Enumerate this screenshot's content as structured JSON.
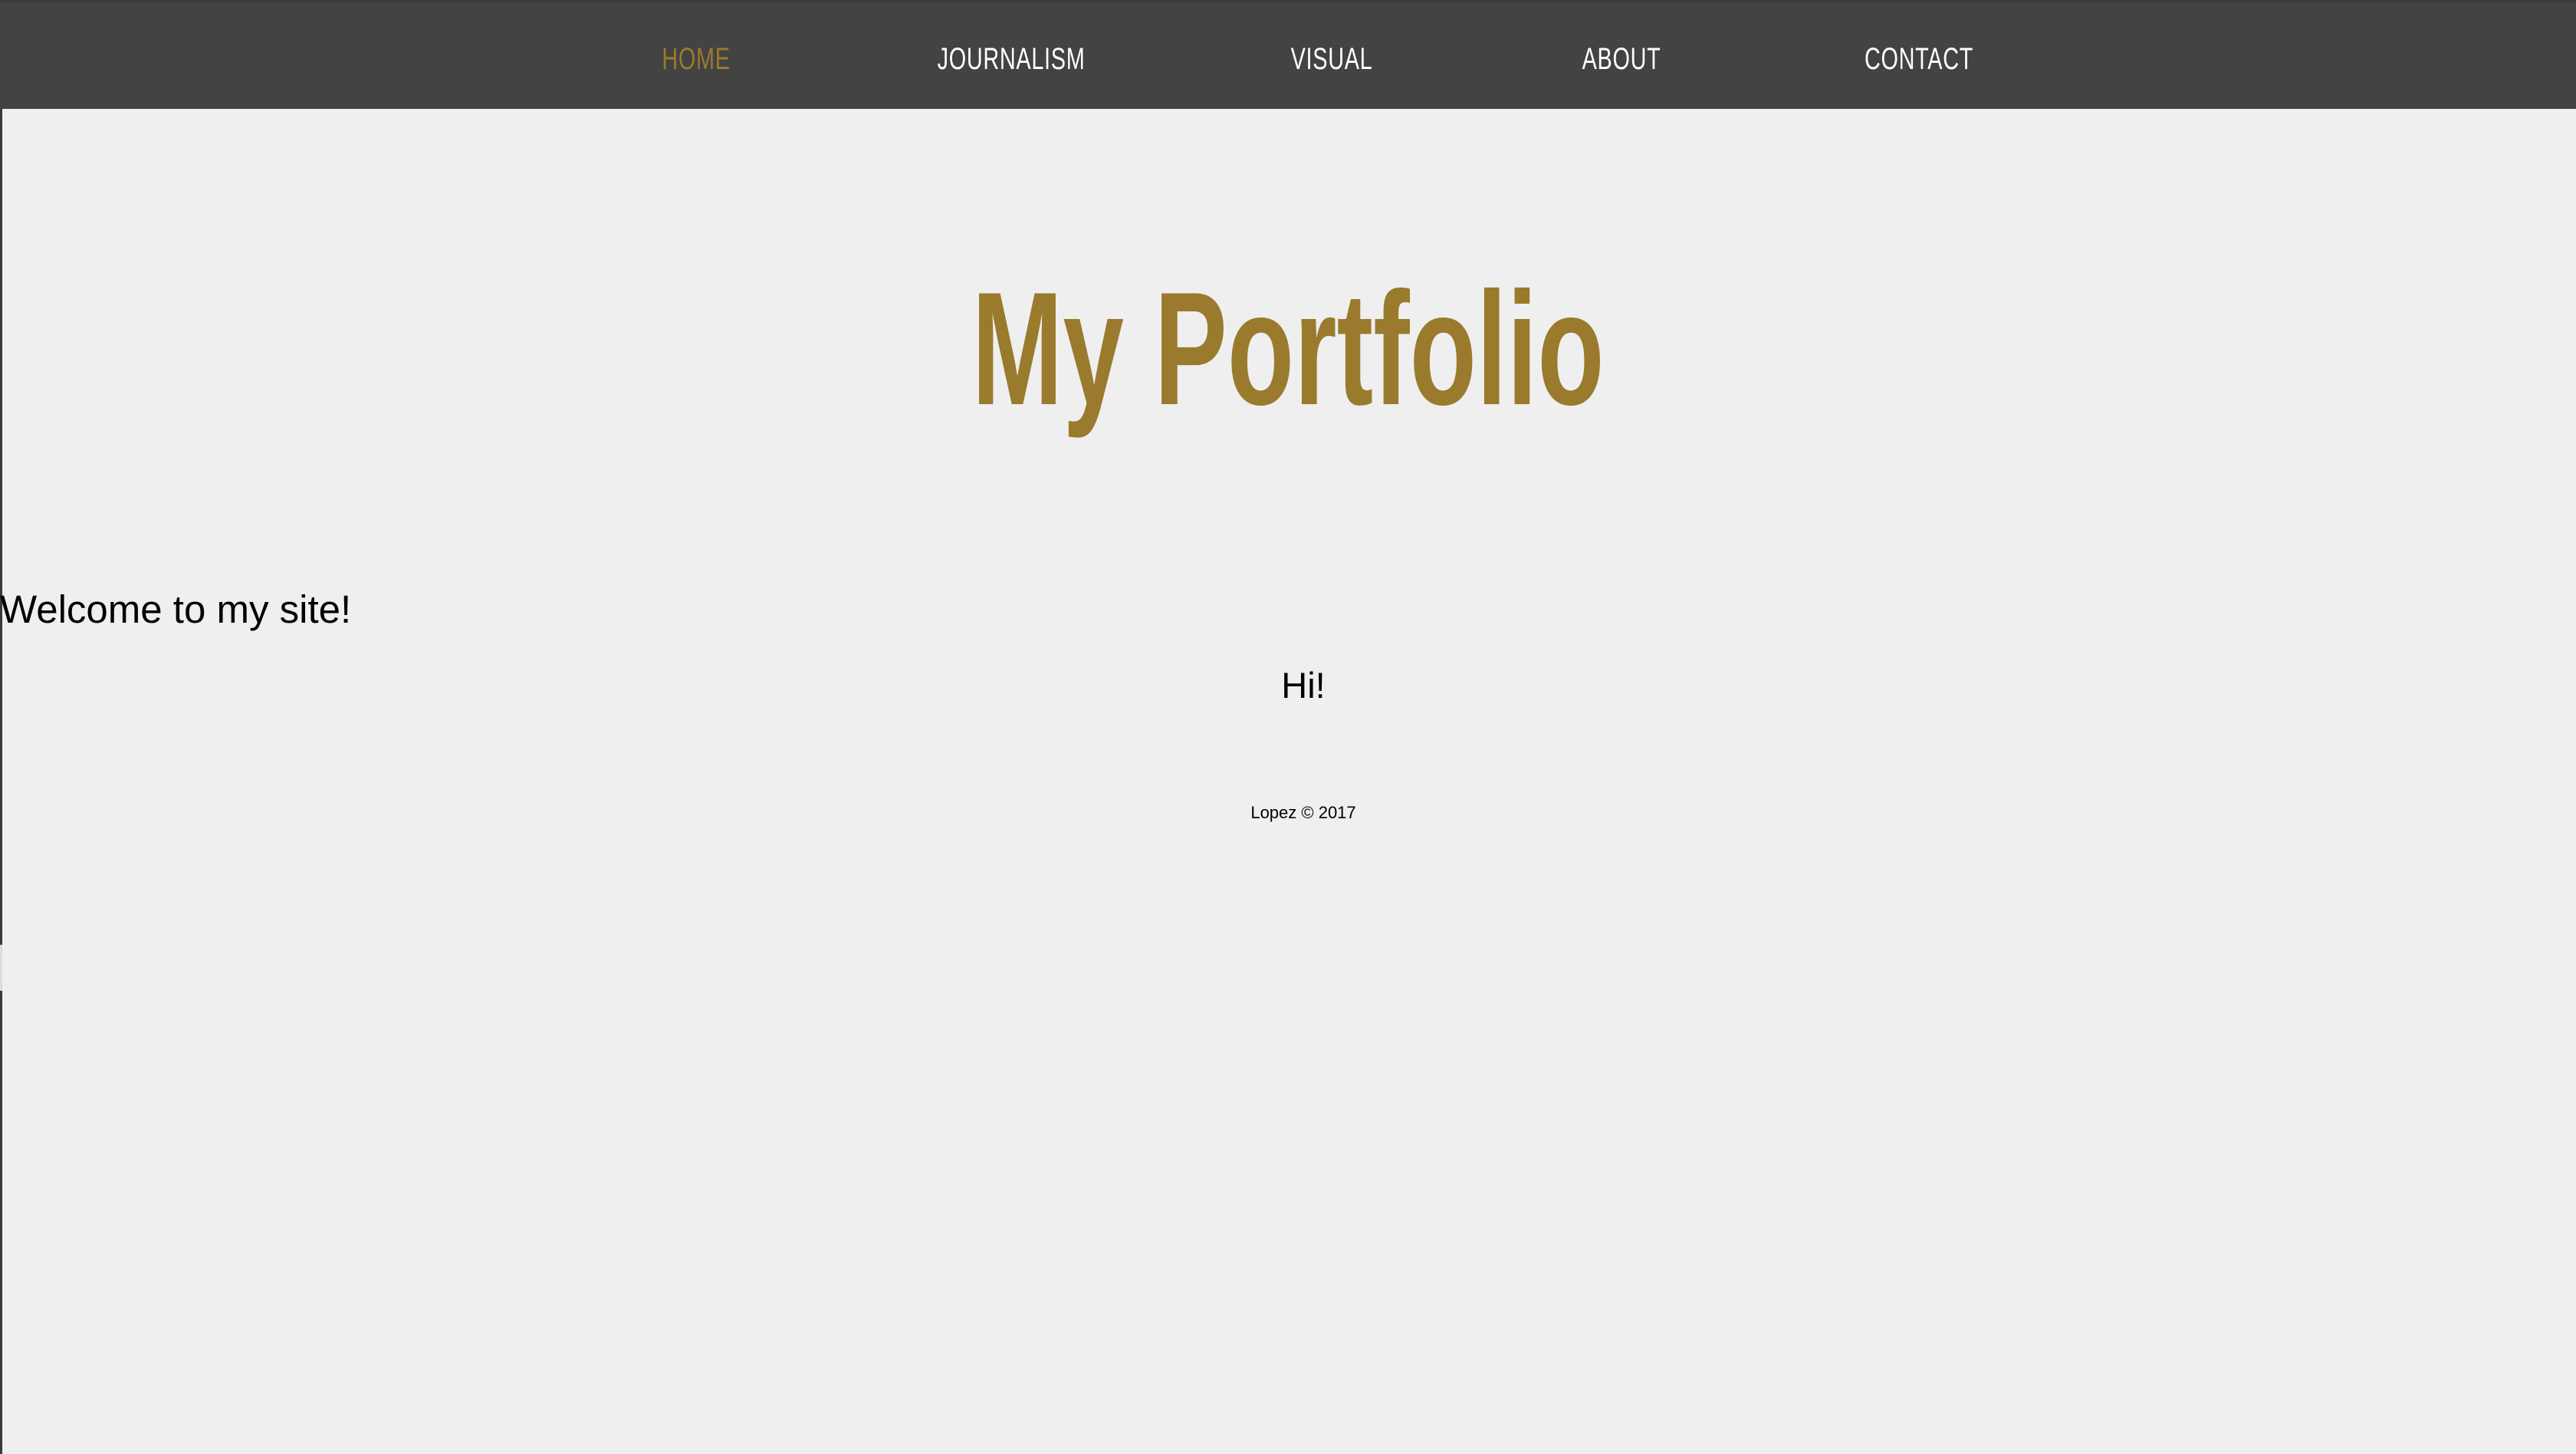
{
  "nav": {
    "items": [
      {
        "label": "HOME",
        "active": true
      },
      {
        "label": "JOURNALISM",
        "active": false
      },
      {
        "label": "VISUAL",
        "active": false
      },
      {
        "label": "ABOUT",
        "active": false
      },
      {
        "label": "CONTACT",
        "active": false
      }
    ]
  },
  "hero": {
    "title": "My Portfolio"
  },
  "main": {
    "welcome": "Welcome to my site!",
    "greeting": "Hi!"
  },
  "footer": {
    "text": "Lopez © 2017"
  },
  "colors": {
    "nav_background": "#434343",
    "page_background": "#efefef",
    "accent": "#9a7a2c",
    "nav_text": "#ffffff"
  }
}
